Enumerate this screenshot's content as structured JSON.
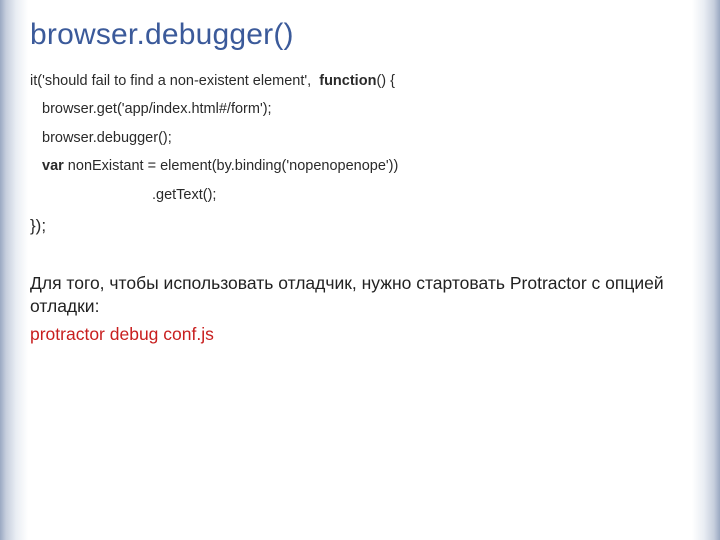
{
  "title": "browser.debugger()",
  "code": {
    "it_a": "it('should fail to find a non-existent element',  ",
    "it_kw": "function",
    "it_b": "() {",
    "get": "browser.get('app/index.html#/form');",
    "dbg": "browser.debugger();",
    "var_kw": "var",
    "var_rest": " nonExistant = element(by.binding('nopenopenope'))",
    "gettext": ".getText();",
    "close": "});"
  },
  "description": "Для того, чтобы использовать отладчик, нужно стартовать Protractor с опцией отладки:",
  "command": "protractor debug conf.js"
}
